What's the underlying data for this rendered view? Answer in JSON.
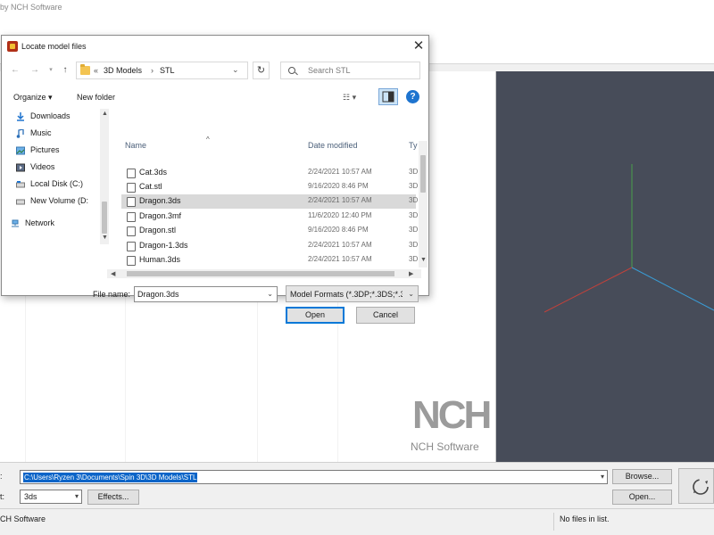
{
  "app": {
    "title": "by NCH Software",
    "brand_logo": "NCH",
    "brand_name": "NCH Software"
  },
  "dialog": {
    "title": "Locate model files",
    "breadcrumb": [
      "3D Models",
      "STL"
    ],
    "breadcrumb_overflow": "«",
    "search_placeholder": "Search STL",
    "organize_label": "Organize ▾",
    "new_folder_label": "New folder",
    "help_label": "?",
    "nav_items": [
      {
        "label": "Downloads",
        "icon": "download-icon"
      },
      {
        "label": "Music",
        "icon": "music-icon"
      },
      {
        "label": "Pictures",
        "icon": "pictures-icon"
      },
      {
        "label": "Videos",
        "icon": "videos-icon"
      },
      {
        "label": "Local Disk (C:)",
        "icon": "drive-icon"
      },
      {
        "label": "New Volume (D:",
        "icon": "drive-icon"
      },
      {
        "label": "Network",
        "icon": "network-icon"
      }
    ],
    "columns": {
      "name": "Name",
      "date": "Date modified",
      "type": "Ty"
    },
    "files": [
      {
        "name": "Cat.3ds",
        "date": "2/24/2021 10:57 AM",
        "type": "3D"
      },
      {
        "name": "Cat.stl",
        "date": "9/16/2020 8:46 PM",
        "type": "3D"
      },
      {
        "name": "Dragon.3ds",
        "date": "2/24/2021 10:57 AM",
        "type": "3D"
      },
      {
        "name": "Dragon.3mf",
        "date": "11/6/2020 12:40 PM",
        "type": "3D"
      },
      {
        "name": "Dragon.stl",
        "date": "9/16/2020 8:46 PM",
        "type": "3D"
      },
      {
        "name": "Dragon-1.3ds",
        "date": "2/24/2021 10:57 AM",
        "type": "3D"
      },
      {
        "name": "Human.3ds",
        "date": "2/24/2021 10:57 AM",
        "type": "3D"
      }
    ],
    "selected_file_index": 2,
    "file_name_label": "File name:",
    "file_name_value": "Dragon.3ds",
    "file_type_value": "Model Formats (*.3DP;*.3DS;*.3",
    "open_label": "Open",
    "cancel_label": "Cancel"
  },
  "bottom": {
    "path_label": ":",
    "path_value": "C:\\Users\\Ryzen 3\\Documents\\Spin 3D\\3D Models\\STL",
    "browse_label": "Browse...",
    "format_label": "t:",
    "format_value": "3ds",
    "effects_label": "Effects...",
    "open_label": "Open..."
  },
  "status": {
    "left": "CH Software",
    "right": "No files in list."
  },
  "colors": {
    "viewport_bg": "#474c59",
    "axis_x": "#c0413b",
    "axis_y": "#4aa04a",
    "axis_z": "#3a9bd4",
    "selection": "#0a64c8"
  }
}
